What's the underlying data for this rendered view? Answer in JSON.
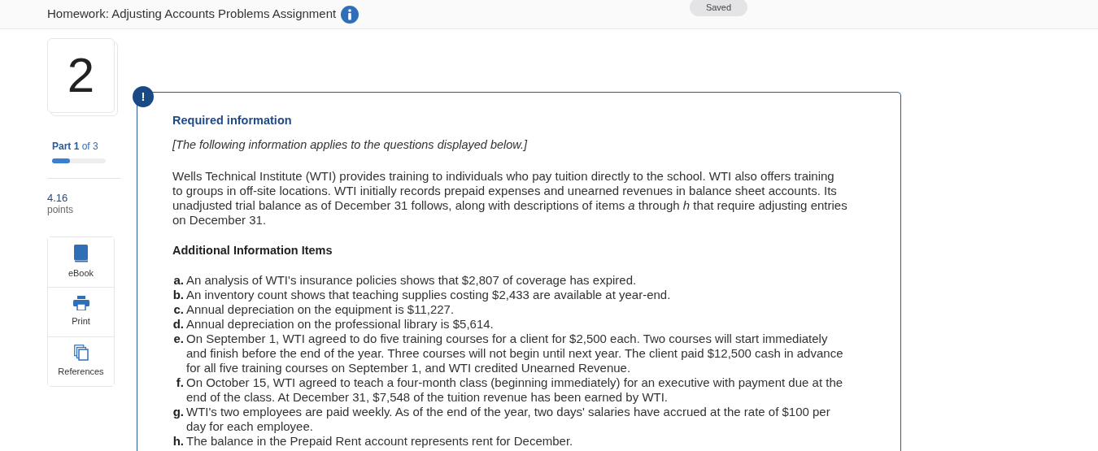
{
  "header": {
    "title": "Homework: Adjusting Accounts Problems Assignment",
    "status": "Saved"
  },
  "question": {
    "number": "2",
    "part_label": "Part",
    "part_current": "1",
    "part_of": "of 3",
    "progress": {
      "level": 0.33
    },
    "points": "4.16",
    "points_label": "points"
  },
  "tools": [
    {
      "kind": "book",
      "label": "eBook"
    },
    {
      "kind": "print",
      "label": "Print"
    },
    {
      "kind": "copies",
      "label": "References"
    }
  ],
  "info": {
    "alert": "!",
    "heading": "Required information",
    "note": "[The following information applies to the questions displayed below.]",
    "intro": "Wells Technical Institute (WTI) provides training to individuals who pay tuition directly to the school. WTI also offers training to groups in off-site locations. WTI initially records prepaid expenses and unearned revenues in balance sheet accounts. Its unadjusted trial balance as of December 31 follows, along with descriptions of items *a* through *h* that require adjusting entries on December 31.",
    "items_heading": "Additional Information Items",
    "items": [
      {
        "letter": "a.",
        "text": "An analysis of WTI's insurance policies shows that $2,807 of coverage has expired."
      },
      {
        "letter": "b.",
        "text": "An inventory count shows that teaching supplies costing $2,433 are available at year-end."
      },
      {
        "letter": "c.",
        "text": "Annual depreciation on the equipment is $11,227."
      },
      {
        "letter": "d.",
        "text": "Annual depreciation on the professional library is $5,614."
      },
      {
        "letter": "e.",
        "text": "On September 1, WTI agreed to do five training courses for a client for $2,500 each. Two courses will start immediately and finish before the end of the year. Three courses will not begin until next year. The client paid $12,500 cash in advance for all five training courses on September 1, and WTI credited Unearned Revenue."
      },
      {
        "letter": "f.",
        "text": "On October 15, WTI agreed to teach a four-month class (beginning immediately) for an executive with payment due at the end of the class. At December 31, $7,548 of the tuition revenue has been earned by WTI."
      },
      {
        "letter": "g.",
        "text": "WTI's two employees are paid weekly. As of the end of the year, two days' salaries have accrued at the rate of $100 per day for each employee."
      },
      {
        "letter": "h.",
        "text": "The balance in the Prepaid Rent account represents rent for December."
      }
    ]
  }
}
